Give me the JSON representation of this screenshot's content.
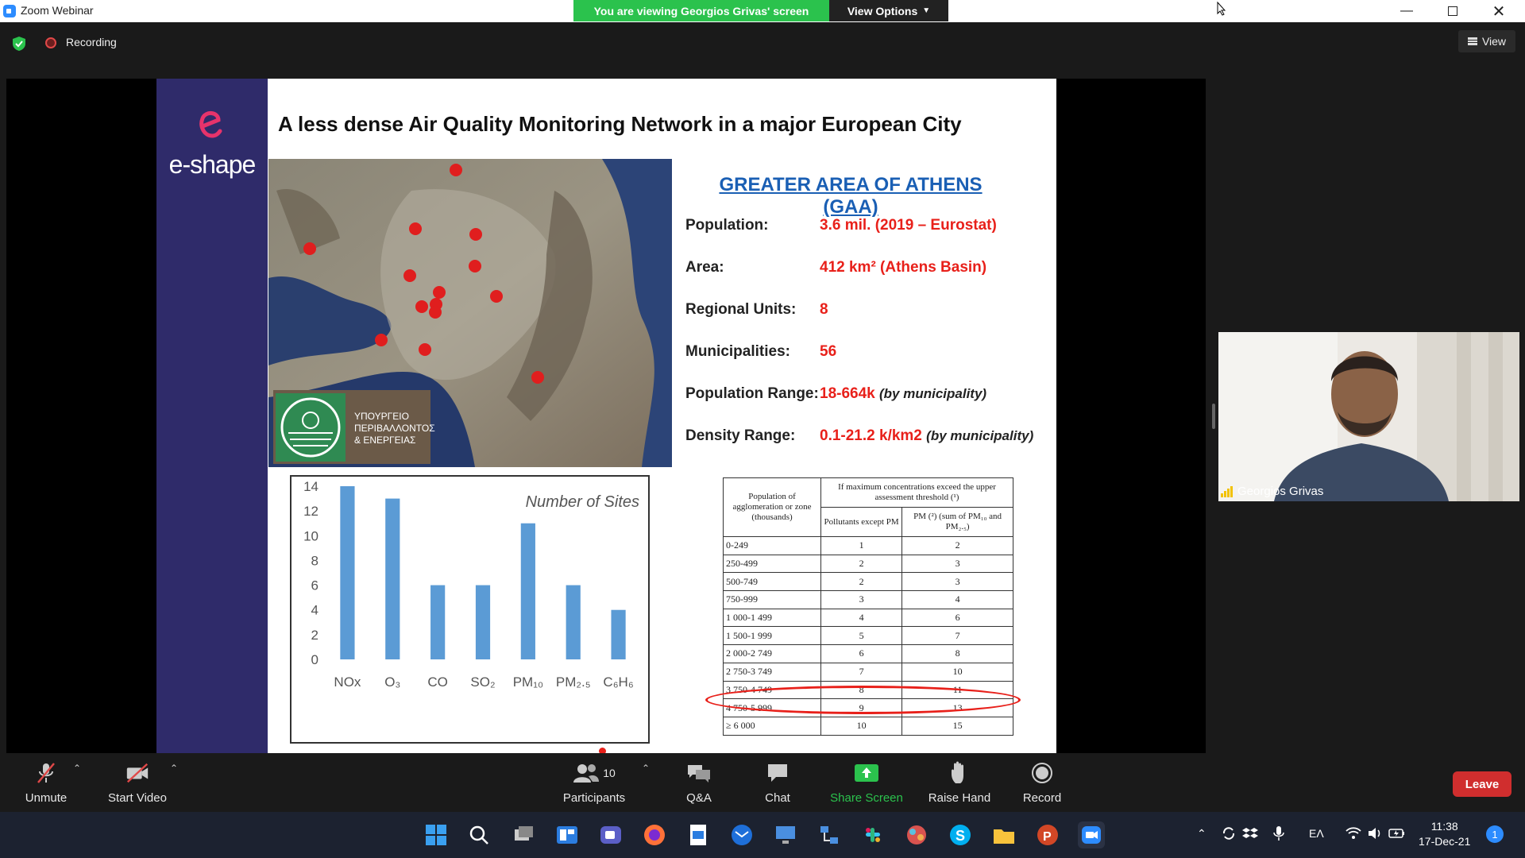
{
  "window": {
    "title": "Zoom Webinar",
    "viewing_banner": "You are viewing Georgios Grivas' screen",
    "view_options": "View Options"
  },
  "status": {
    "recording_label": "Recording",
    "view_label": "View"
  },
  "slide": {
    "logo_text": "e-shape",
    "title": "A less dense Air Quality Monitoring Network in a major European City",
    "ministry_text": [
      "ΥΠΟΥΡΓΕΙΟ",
      "ΠΕΡΙΒΑΛΛΟΝΤΟΣ",
      "& ΕΝΕΡΓΕΙΑΣ"
    ],
    "info_title": "GREATER AREA OF ATHENS (GAA)",
    "info": [
      {
        "label": "Population:",
        "value": "3.6 mil. (2019 – Eurostat)",
        "note": ""
      },
      {
        "label": "Area:",
        "value": "412 km² (Athens Basin)",
        "note": ""
      },
      {
        "label": "Regional Units:",
        "value": "8",
        "note": ""
      },
      {
        "label": "Municipalities:",
        "value": "56",
        "note": ""
      },
      {
        "label": "Population Range:",
        "value": "18-664k",
        "note": "(by municipality)"
      },
      {
        "label": "Density Range:",
        "value": "0.1-21.2 k/km2",
        "note": "(by municipality)"
      }
    ],
    "table": {
      "header_col1": "Population of agglomeration or zone (thousands)",
      "header_group": "If maximum concentrations exceed the upper assessment threshold (¹)",
      "header_col2": "Pollutants except PM",
      "header_col3": "PM (²) (sum of PM₁₀ and PM₂.₅)",
      "rows": [
        [
          "0-249",
          "1",
          "2"
        ],
        [
          "250-499",
          "2",
          "3"
        ],
        [
          "500-749",
          "2",
          "3"
        ],
        [
          "750-999",
          "3",
          "4"
        ],
        [
          "1 000-1 499",
          "4",
          "6"
        ],
        [
          "1 500-1 999",
          "5",
          "7"
        ],
        [
          "2 000-2 749",
          "6",
          "8"
        ],
        [
          "2 750-3 749",
          "7",
          "10"
        ],
        [
          "3 750-4 749",
          "8",
          "11"
        ],
        [
          "4 750-5 999",
          "9",
          "13"
        ],
        [
          "≥ 6 000",
          "10",
          "15"
        ]
      ]
    }
  },
  "chart_data": {
    "type": "bar",
    "title": "Number of Sites",
    "categories": [
      "NOx",
      "O₃",
      "CO",
      "SO₂",
      "PM₁₀",
      "PM₂.₅",
      "C₆H₆"
    ],
    "values": [
      14,
      13,
      6,
      6,
      11,
      6,
      4
    ],
    "ylim": [
      0,
      14
    ],
    "yticks": [
      0,
      2,
      4,
      6,
      8,
      10,
      12,
      14
    ],
    "bar_color": "#5b9bd5",
    "grid": false,
    "xlabel": "",
    "ylabel": ""
  },
  "video": {
    "participant_name": "Georgios Grivas"
  },
  "toolbar": {
    "unmute": "Unmute",
    "start_video": "Start Video",
    "participants": "Participants",
    "participants_count": "10",
    "qa": "Q&A",
    "chat": "Chat",
    "share_screen": "Share Screen",
    "raise_hand": "Raise Hand",
    "record": "Record",
    "leave": "Leave"
  },
  "taskbar": {
    "language": "ΕΛ",
    "time": "11:38",
    "date": "17-Dec-21",
    "notifications": "1"
  },
  "colors": {
    "sidebar": "#2f2b6a",
    "banner_green": "#2bc24d",
    "leave_red": "#d02e2e",
    "share_green": "#2bc24d",
    "highlight_red": "#e8201a",
    "gaa_blue": "#1a5fb4"
  }
}
